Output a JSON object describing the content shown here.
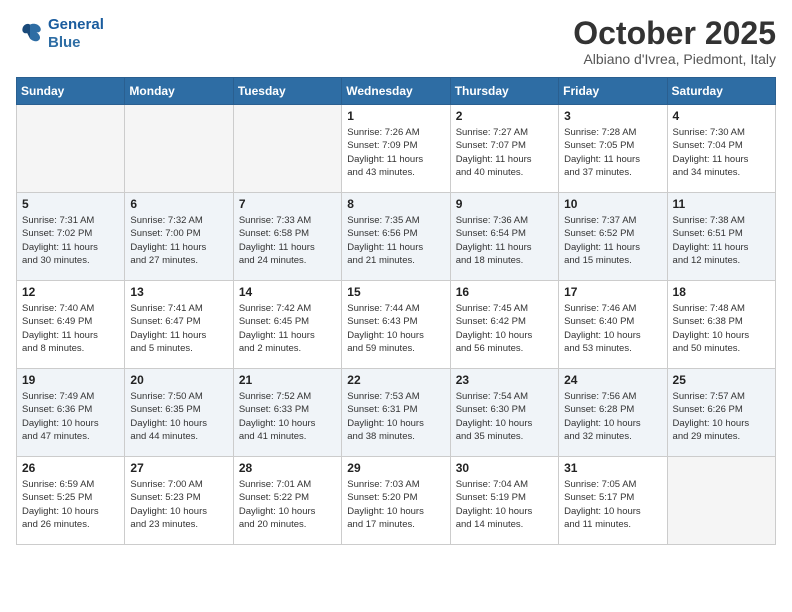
{
  "header": {
    "logo_line1": "General",
    "logo_line2": "Blue",
    "month_title": "October 2025",
    "location": "Albiano d'Ivrea, Piedmont, Italy"
  },
  "days_of_week": [
    "Sunday",
    "Monday",
    "Tuesday",
    "Wednesday",
    "Thursday",
    "Friday",
    "Saturday"
  ],
  "weeks": [
    [
      {
        "day": "",
        "info": ""
      },
      {
        "day": "",
        "info": ""
      },
      {
        "day": "",
        "info": ""
      },
      {
        "day": "1",
        "info": "Sunrise: 7:26 AM\nSunset: 7:09 PM\nDaylight: 11 hours\nand 43 minutes."
      },
      {
        "day": "2",
        "info": "Sunrise: 7:27 AM\nSunset: 7:07 PM\nDaylight: 11 hours\nand 40 minutes."
      },
      {
        "day": "3",
        "info": "Sunrise: 7:28 AM\nSunset: 7:05 PM\nDaylight: 11 hours\nand 37 minutes."
      },
      {
        "day": "4",
        "info": "Sunrise: 7:30 AM\nSunset: 7:04 PM\nDaylight: 11 hours\nand 34 minutes."
      }
    ],
    [
      {
        "day": "5",
        "info": "Sunrise: 7:31 AM\nSunset: 7:02 PM\nDaylight: 11 hours\nand 30 minutes."
      },
      {
        "day": "6",
        "info": "Sunrise: 7:32 AM\nSunset: 7:00 PM\nDaylight: 11 hours\nand 27 minutes."
      },
      {
        "day": "7",
        "info": "Sunrise: 7:33 AM\nSunset: 6:58 PM\nDaylight: 11 hours\nand 24 minutes."
      },
      {
        "day": "8",
        "info": "Sunrise: 7:35 AM\nSunset: 6:56 PM\nDaylight: 11 hours\nand 21 minutes."
      },
      {
        "day": "9",
        "info": "Sunrise: 7:36 AM\nSunset: 6:54 PM\nDaylight: 11 hours\nand 18 minutes."
      },
      {
        "day": "10",
        "info": "Sunrise: 7:37 AM\nSunset: 6:52 PM\nDaylight: 11 hours\nand 15 minutes."
      },
      {
        "day": "11",
        "info": "Sunrise: 7:38 AM\nSunset: 6:51 PM\nDaylight: 11 hours\nand 12 minutes."
      }
    ],
    [
      {
        "day": "12",
        "info": "Sunrise: 7:40 AM\nSunset: 6:49 PM\nDaylight: 11 hours\nand 8 minutes."
      },
      {
        "day": "13",
        "info": "Sunrise: 7:41 AM\nSunset: 6:47 PM\nDaylight: 11 hours\nand 5 minutes."
      },
      {
        "day": "14",
        "info": "Sunrise: 7:42 AM\nSunset: 6:45 PM\nDaylight: 11 hours\nand 2 minutes."
      },
      {
        "day": "15",
        "info": "Sunrise: 7:44 AM\nSunset: 6:43 PM\nDaylight: 10 hours\nand 59 minutes."
      },
      {
        "day": "16",
        "info": "Sunrise: 7:45 AM\nSunset: 6:42 PM\nDaylight: 10 hours\nand 56 minutes."
      },
      {
        "day": "17",
        "info": "Sunrise: 7:46 AM\nSunset: 6:40 PM\nDaylight: 10 hours\nand 53 minutes."
      },
      {
        "day": "18",
        "info": "Sunrise: 7:48 AM\nSunset: 6:38 PM\nDaylight: 10 hours\nand 50 minutes."
      }
    ],
    [
      {
        "day": "19",
        "info": "Sunrise: 7:49 AM\nSunset: 6:36 PM\nDaylight: 10 hours\nand 47 minutes."
      },
      {
        "day": "20",
        "info": "Sunrise: 7:50 AM\nSunset: 6:35 PM\nDaylight: 10 hours\nand 44 minutes."
      },
      {
        "day": "21",
        "info": "Sunrise: 7:52 AM\nSunset: 6:33 PM\nDaylight: 10 hours\nand 41 minutes."
      },
      {
        "day": "22",
        "info": "Sunrise: 7:53 AM\nSunset: 6:31 PM\nDaylight: 10 hours\nand 38 minutes."
      },
      {
        "day": "23",
        "info": "Sunrise: 7:54 AM\nSunset: 6:30 PM\nDaylight: 10 hours\nand 35 minutes."
      },
      {
        "day": "24",
        "info": "Sunrise: 7:56 AM\nSunset: 6:28 PM\nDaylight: 10 hours\nand 32 minutes."
      },
      {
        "day": "25",
        "info": "Sunrise: 7:57 AM\nSunset: 6:26 PM\nDaylight: 10 hours\nand 29 minutes."
      }
    ],
    [
      {
        "day": "26",
        "info": "Sunrise: 6:59 AM\nSunset: 5:25 PM\nDaylight: 10 hours\nand 26 minutes."
      },
      {
        "day": "27",
        "info": "Sunrise: 7:00 AM\nSunset: 5:23 PM\nDaylight: 10 hours\nand 23 minutes."
      },
      {
        "day": "28",
        "info": "Sunrise: 7:01 AM\nSunset: 5:22 PM\nDaylight: 10 hours\nand 20 minutes."
      },
      {
        "day": "29",
        "info": "Sunrise: 7:03 AM\nSunset: 5:20 PM\nDaylight: 10 hours\nand 17 minutes."
      },
      {
        "day": "30",
        "info": "Sunrise: 7:04 AM\nSunset: 5:19 PM\nDaylight: 10 hours\nand 14 minutes."
      },
      {
        "day": "31",
        "info": "Sunrise: 7:05 AM\nSunset: 5:17 PM\nDaylight: 10 hours\nand 11 minutes."
      },
      {
        "day": "",
        "info": ""
      }
    ]
  ]
}
